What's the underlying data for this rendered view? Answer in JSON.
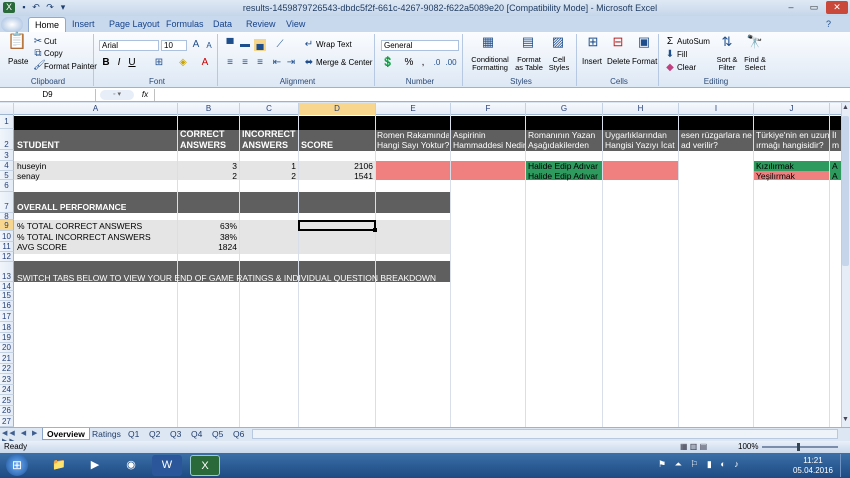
{
  "window": {
    "title": "results-1459879726543-dbdc5f2f-661c-4267-9082-f622a5089e20  [Compatibility Mode] - Microsoft Excel",
    "minimize": "–",
    "maximize": "▭",
    "close": "✕"
  },
  "ribbon_tabs": [
    "Home",
    "Insert",
    "Page Layout",
    "Formulas",
    "Data",
    "Review",
    "View"
  ],
  "ribbon": {
    "clipboard": {
      "label": "Clipboard",
      "paste": "Paste",
      "cut": "Cut",
      "copy": "Copy",
      "format_painter": "Format Painter"
    },
    "font": {
      "label": "Font",
      "font_name": "Arial",
      "font_size": "10",
      "bold": "B",
      "italic": "I",
      "underline": "U"
    },
    "alignment": {
      "label": "Alignment",
      "wrap_text": "Wrap Text",
      "merge_center": "Merge & Center"
    },
    "number": {
      "label": "Number",
      "format": "General",
      "percent": "%",
      "comma": ","
    },
    "styles": {
      "label": "Styles",
      "conditional_formatting": "Conditional Formatting",
      "format_as_table": "Format as Table",
      "cell_styles": "Cell Styles"
    },
    "cells": {
      "label": "Cells",
      "insert": "Insert",
      "delete": "Delete",
      "format": "Format"
    },
    "editing": {
      "label": "Editing",
      "autosum": "AutoSum",
      "fill": "Fill",
      "clear": "Clear",
      "sort_filter": "Sort & Filter",
      "find_select": "Find & Select"
    }
  },
  "formula_bar": {
    "name_box": "D9",
    "fx": "fx",
    "formula": ""
  },
  "columns": [
    "A",
    "B",
    "C",
    "D",
    "E",
    "F",
    "G",
    "H",
    "I",
    "J"
  ],
  "rows": [
    "1",
    "2",
    "3",
    "4",
    "5",
    "6",
    "7",
    "8",
    "9",
    "10",
    "11",
    "12",
    "13",
    "14",
    "15",
    "16",
    "17",
    "18",
    "19",
    "20",
    "21",
    "22",
    "23",
    "24",
    "25",
    "26",
    "27"
  ],
  "cells": {
    "a2": "STUDENT",
    "b2a": "CORRECT",
    "b2b": "ANSWERS",
    "c2a": "INCORRECT",
    "c2b": "ANSWERS",
    "d2": "SCORE",
    "e2a": "Romen Rakamında",
    "e2b": "Hangi Sayı Yoktur?",
    "f2a": "Aspirinin",
    "f2b": "Hammaddesi Nedir?",
    "g2a": "Romanının Yazan",
    "g2b": "Aşağıdakilerden",
    "h2a": "Uygarlıklarından",
    "h2b": "Hangisi Yazıyı İcat",
    "i2a": "esen rüzgarlara ne",
    "i2b": "ad verilir?",
    "j2a": "Türkiye'nin en uzun",
    "j2b": "ırmağı hangisidir?",
    "k2a": "İl",
    "k2b": "m",
    "a4": "huseyin",
    "b4": "3",
    "c4": "1",
    "d4": "2106",
    "g4": "Halide Edip Adıvar",
    "j4": "Kızılırmak",
    "k4": "A",
    "a5": "senay",
    "b5": "2",
    "c5": "2",
    "d5": "1541",
    "g5": "Halide Edip Adıvar",
    "j5": "Yeşilırmak",
    "k5": "A",
    "a7": "OVERALL PERFORMANCE",
    "a9": "% TOTAL CORRECT ANSWERS",
    "b9": "63%",
    "a10": "% TOTAL INCORRECT ANSWERS",
    "b10": "38%",
    "a11": "AVG SCORE",
    "b11": "1824",
    "a13": "SWITCH TABS BELOW TO VIEW YOUR END OF GAME RATINGS & INDIVIDUAL QUESTION BREAKDOWN"
  },
  "sheet_tabs": [
    "Overview",
    "Ratings",
    "Q1",
    "Q2",
    "Q3",
    "Q4",
    "Q5",
    "Q6"
  ],
  "status": {
    "ready": "Ready",
    "zoom": "100%"
  },
  "taskbar": {
    "time": "11:21",
    "date": "05.04.2016"
  },
  "colors": {
    "header_dark": "#5f5f5f",
    "wrong": "#f08080",
    "right": "#2e9a5e",
    "panel": "#e5e5e5",
    "selection": "#f8d68e"
  }
}
